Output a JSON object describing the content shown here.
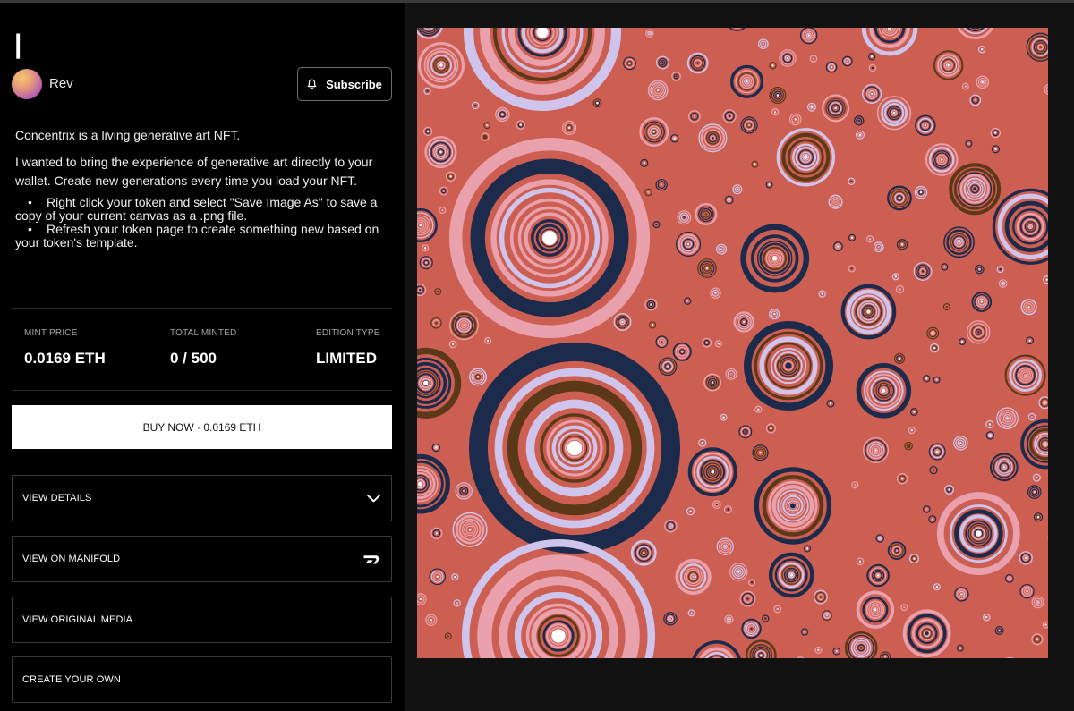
{
  "page": {
    "title": "|",
    "author": "Rev",
    "subscribe_label": "Subscribe"
  },
  "description": {
    "paragraphs": [
      "Concentrix is a living generative art NFT.",
      "I wanted to bring the experience of generative art directly to your wallet. Create new generations every time you load your NFT."
    ],
    "bullets": [
      "Right click your token and select \"Save Image As\" to save a copy of your current canvas as a .png file.",
      "Refresh your token page to create something new based on your token's template."
    ]
  },
  "stats": [
    {
      "label": "MINT PRICE",
      "value": "0.0169 ETH"
    },
    {
      "label": "TOTAL MINTED",
      "value": "0 / 500"
    },
    {
      "label": "EDITION TYPE",
      "value": "LIMITED"
    }
  ],
  "buy_label": "BUY NOW · 0.0169 ETH",
  "actions": [
    {
      "label": "VIEW DETAILS",
      "icon": "chevron-down-icon"
    },
    {
      "label": "VIEW ON MANIFOLD",
      "icon": "manifold-logo-icon"
    },
    {
      "label": "VIEW ORIGINAL MEDIA",
      "icon": ""
    },
    {
      "label": "CREATE YOUR OWN",
      "icon": ""
    }
  ],
  "colors": {
    "art_background": "#cd5f52",
    "ring_palette": [
      "#ffffff",
      "#e9a2ad",
      "#cfc5ec",
      "#1c2a4c",
      "#5a3818",
      "#c4574c"
    ]
  }
}
